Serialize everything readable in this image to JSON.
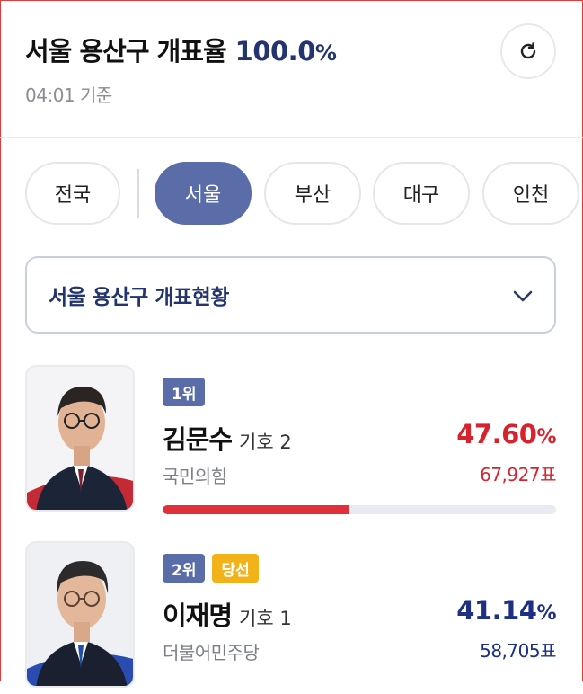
{
  "header": {
    "title": "서울 용산구 개표율",
    "rate_value": "100.0",
    "rate_unit": "%",
    "time": "04:01 기준"
  },
  "tabs": [
    {
      "label": "전국",
      "active": false
    },
    {
      "label": "서울",
      "active": true
    },
    {
      "label": "부산",
      "active": false
    },
    {
      "label": "대구",
      "active": false
    },
    {
      "label": "인천",
      "active": false
    }
  ],
  "selector": {
    "label": "서울 용산구 개표현황"
  },
  "candidates": [
    {
      "rank": "1위",
      "name": "김문수",
      "symbol": "기호 2",
      "party": "국민의힘",
      "percent": "47.60",
      "percent_unit": "%",
      "votes": "67,927표",
      "share": 0.476,
      "color": "#d8232f",
      "winner_badge": ""
    },
    {
      "rank": "2위",
      "name": "이재명",
      "symbol": "기호 1",
      "party": "더불어민주당",
      "percent": "41.14",
      "percent_unit": "%",
      "votes": "58,705표",
      "share": 0.4114,
      "color": "#1e2f86",
      "winner_badge": "당선"
    }
  ],
  "colors": {
    "accent": "#5a6da8",
    "navy": "#23346e",
    "red": "#d8232f",
    "winner": "#f2b31a"
  }
}
